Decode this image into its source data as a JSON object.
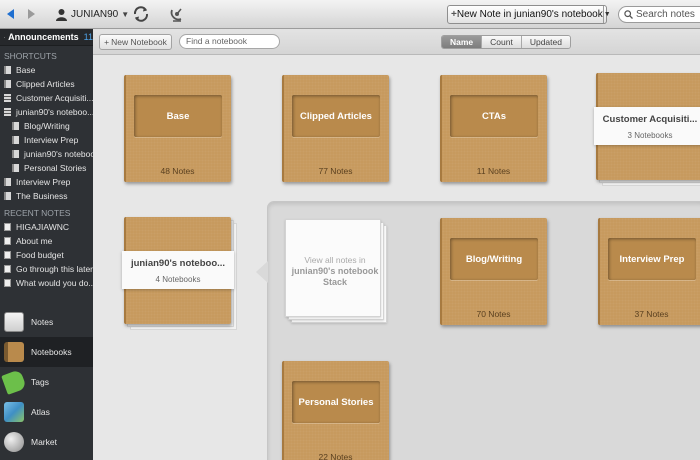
{
  "toolbar": {
    "user": "JUNIAN90",
    "new_note_label": "New Note in junian90's notebook",
    "search_placeholder": "Search notes"
  },
  "sidebar": {
    "announcements": {
      "label": "Announcements",
      "count": "11"
    },
    "shortcuts_heading": "SHORTCUTS",
    "shortcuts": [
      {
        "label": "Base",
        "icon": "notebook-icon",
        "indent": 0
      },
      {
        "label": "Clipped Articles",
        "icon": "notebook-icon",
        "indent": 0
      },
      {
        "label": "Customer Acquisiti...",
        "icon": "stack-icon",
        "indent": 0
      },
      {
        "label": "junian90's noteboo...",
        "icon": "stack-icon",
        "indent": 0
      },
      {
        "label": "Blog/Writing",
        "icon": "notebook-icon",
        "indent": 1
      },
      {
        "label": "Interview Prep",
        "icon": "notebook-icon",
        "indent": 1
      },
      {
        "label": "junian90's notebook",
        "icon": "notebook-icon",
        "indent": 1
      },
      {
        "label": "Personal Stories",
        "icon": "notebook-icon",
        "indent": 1
      },
      {
        "label": "Interview Prep",
        "icon": "notebook-icon",
        "indent": 0
      },
      {
        "label": "The Business",
        "icon": "notebook-icon",
        "indent": 0
      }
    ],
    "recent_heading": "RECENT NOTES",
    "recent": [
      {
        "label": "HIGAJIAWNC"
      },
      {
        "label": "About me"
      },
      {
        "label": "Food budget"
      },
      {
        "label": "Go through this later"
      },
      {
        "label": "What would you do..."
      }
    ],
    "nav": [
      {
        "label": "Notes",
        "icon": "notes-icon",
        "active": false
      },
      {
        "label": "Notebooks",
        "icon": "notebooks-icon",
        "active": true
      },
      {
        "label": "Tags",
        "icon": "tags-icon",
        "active": false
      },
      {
        "label": "Atlas",
        "icon": "atlas-icon",
        "active": false
      },
      {
        "label": "Market",
        "icon": "market-icon",
        "active": false
      }
    ]
  },
  "main": {
    "new_notebook_label": "New Notebook",
    "find_placeholder": "Find a notebook",
    "sort": [
      {
        "label": "Name",
        "active": true
      },
      {
        "label": "Count",
        "active": false
      },
      {
        "label": "Updated",
        "active": false
      }
    ],
    "notebooks": {
      "base": {
        "title": "Base",
        "count": "48 Notes"
      },
      "clipped": {
        "title": "Clipped Articles",
        "count": "77 Notes"
      },
      "ctas": {
        "title": "CTAs",
        "count": "11 Notes"
      },
      "customer": {
        "title": "Customer Acquisiti...",
        "count": "3 Notebooks"
      },
      "junian": {
        "title": "junian90's noteboo...",
        "count": "4 Notebooks"
      },
      "blog": {
        "title": "Blog/Writing",
        "count": "70 Notes"
      },
      "interview": {
        "title": "Interview Prep",
        "count": "37 Notes"
      },
      "personal": {
        "title": "Personal Stories",
        "count": "22 Notes"
      }
    },
    "view_all": {
      "line1": "View all notes in",
      "line2": "junian90's notebook Stack"
    }
  },
  "colors": {
    "sidebar_bg": "#2e3135",
    "cover": "#c79a5e",
    "accent_count": "#4fa3e8"
  }
}
